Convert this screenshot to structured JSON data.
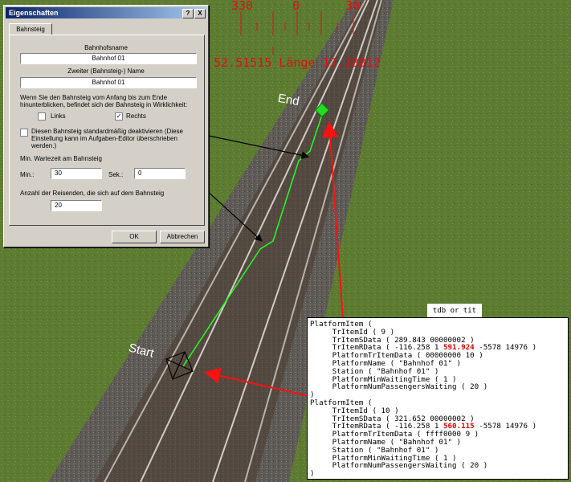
{
  "hud": {
    "compass": [
      "330",
      "0",
      "30"
    ],
    "status": "52.51515 Länge 12.18812"
  },
  "world": {
    "end_label": "End",
    "start_label": "Start"
  },
  "dialog": {
    "title": "Eigenschaften",
    "help_button": "?",
    "close_button": "X",
    "tab": "Bahnsteig",
    "station_name_label": "Bahnhofsname",
    "station_name_value": "Bahnhof 01",
    "platform_name_label": "Zweiter (Bahnsteig-) Name",
    "platform_name_value": "Bahnhof 01",
    "side_question": "Wenn Sie den Bahnsteig vom Anfang bis zum Ende hinunterblicken, befindet sich der Bahnsteig in Wirklichkeit:",
    "side_left": "Links",
    "side_right": "Rechts",
    "side_left_checked": false,
    "side_right_checked": true,
    "deactivate_label": "Diesen Bahnsteig standardmäßig deaktivieren (Diese Einstellung kann im Aufgaben-Editor überschrieben werden.)",
    "deactivate_checked": false,
    "min_wait_label": "Min. Wartezeit am Bahnsteig",
    "min_label": "Min.:",
    "min_value": "30",
    "sec_label": "Sek.:",
    "sec_value": "0",
    "passengers_label": "Anzahl der Reisenden, die sich auf dem Bahnsteig",
    "passengers_value": "20",
    "ok_button": "OK",
    "cancel_button": "Abbrechen"
  },
  "code_panel": {
    "title": "tdb or tit",
    "lines": [
      {
        "text": "PlatformItem ("
      },
      {
        "text": "     TrItemId ( 9 )"
      },
      {
        "text": "     TrItemSData ( 289.843 00000002 )"
      },
      {
        "text": "     TrItemRData ( -116.258 1 ",
        "hl": "591.924",
        "rest": " -5578 14976 )"
      },
      {
        "text": "     PlatformTrItemData ( 00000000 10 )"
      },
      {
        "text": "     PlatformName ( \"Bahnhof 01\" )"
      },
      {
        "text": "     Station ( \"Bahnhof 01\" )"
      },
      {
        "text": "     PlatformMinWaitingTime ( 1 )"
      },
      {
        "text": "     PlatformNumPassengersWaiting ( 20 )"
      },
      {
        "text": ")"
      },
      {
        "text": "PlatformItem ("
      },
      {
        "text": "     TrItemId ( 10 )"
      },
      {
        "text": "     TrItemSData ( 321.652 00000002 )"
      },
      {
        "text": "     TrItemRData ( -116.258 1 ",
        "hl": "560.115",
        "rest": " -5578 14976 )"
      },
      {
        "text": "     PlatformTrItemData ( ffff0000 9 )"
      },
      {
        "text": "     PlatformName ( \"Bahnhof 01\" )"
      },
      {
        "text": "     Station ( \"Bahnhof 01\" )"
      },
      {
        "text": "     PlatformMinWaitingTime ( 1 )"
      },
      {
        "text": "     PlatformNumPassengersWaiting ( 20 )"
      },
      {
        "text": ")"
      }
    ]
  },
  "colors": {
    "hud": "#e01010",
    "title_bar": "#0a246a",
    "dialog_bg": "#d4d0c8",
    "path": "#22ff22",
    "arrow_red": "#ff1010",
    "highlight": "#e00000"
  }
}
